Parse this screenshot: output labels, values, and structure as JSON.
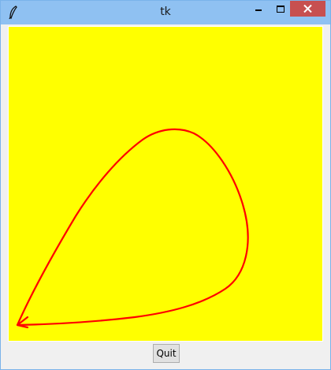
{
  "window": {
    "title": "tk",
    "icon": "feather-icon"
  },
  "titlebar": {
    "minimize_icon": "minimize-icon",
    "maximize_icon": "maximize-icon",
    "close_icon": "close-icon"
  },
  "canvas": {
    "background": "#ffff00",
    "curve_color": "#ff0000"
  },
  "footer": {
    "quit_label": "Quit"
  }
}
